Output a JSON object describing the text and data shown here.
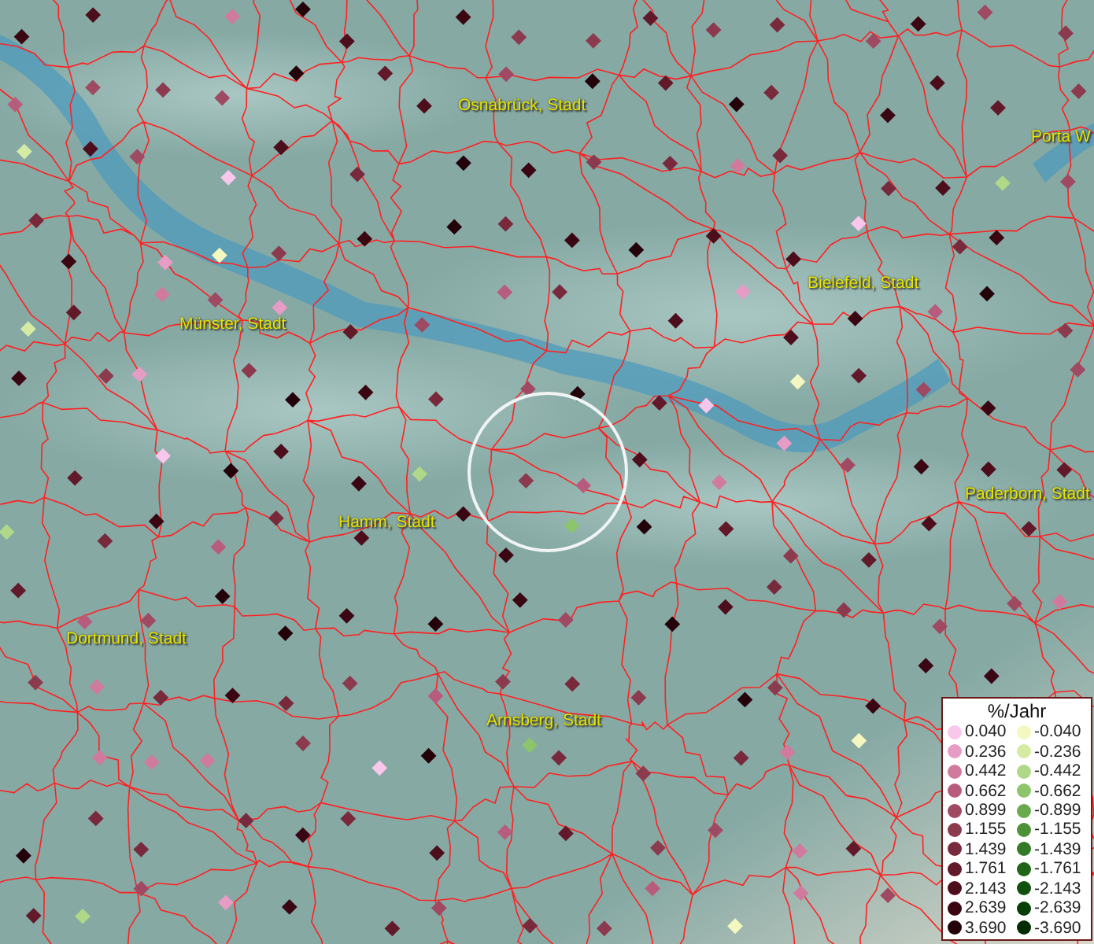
{
  "map": {
    "cities": [
      {
        "name": "Osnabrück, Stadt"
      },
      {
        "name": "Porta W"
      },
      {
        "name": "Bielefeld, Stadt"
      },
      {
        "name": "Münster, Stadt"
      },
      {
        "name": "Paderborn, Stadt"
      },
      {
        "name": "Hamm, Stadt"
      },
      {
        "name": "Dortmund, Stadt"
      },
      {
        "name": "Arnsberg, Stadt"
      }
    ]
  },
  "legend": {
    "title": "%/Jahr",
    "rows": [
      {
        "positive": {
          "value": "0.040",
          "color": "#f9c6ec"
        },
        "negative": {
          "value": "-0.040",
          "color": "#f4f7c0"
        }
      },
      {
        "positive": {
          "value": "0.236",
          "color": "#e79cc6"
        },
        "negative": {
          "value": "-0.236",
          "color": "#d5eba4"
        }
      },
      {
        "positive": {
          "value": "0.442",
          "color": "#d07a9e"
        },
        "negative": {
          "value": "-0.442",
          "color": "#afd888"
        }
      },
      {
        "positive": {
          "value": "0.662",
          "color": "#b85c7e"
        },
        "negative": {
          "value": "-0.662",
          "color": "#8dc56c"
        }
      },
      {
        "positive": {
          "value": "0.899",
          "color": "#a04962"
        },
        "negative": {
          "value": "-0.899",
          "color": "#6aaa4e"
        }
      },
      {
        "positive": {
          "value": "1.155",
          "color": "#8c3a4e"
        },
        "negative": {
          "value": "-1.155",
          "color": "#4e9238"
        }
      },
      {
        "positive": {
          "value": "1.439",
          "color": "#782a3c"
        },
        "negative": {
          "value": "-1.439",
          "color": "#357a26"
        }
      },
      {
        "positive": {
          "value": "1.761",
          "color": "#62192a"
        },
        "negative": {
          "value": "-1.761",
          "color": "#1f6417"
        }
      },
      {
        "positive": {
          "value": "2.143",
          "color": "#4d0e1c"
        },
        "negative": {
          "value": "-2.143",
          "color": "#11500d"
        }
      },
      {
        "positive": {
          "value": "2.639",
          "color": "#3a0612"
        },
        "negative": {
          "value": "-2.639",
          "color": "#083e07"
        }
      },
      {
        "positive": {
          "value": "3.690",
          "color": "#24020a"
        },
        "negative": {
          "value": "-3.690",
          "color": "#022c02"
        }
      }
    ]
  }
}
